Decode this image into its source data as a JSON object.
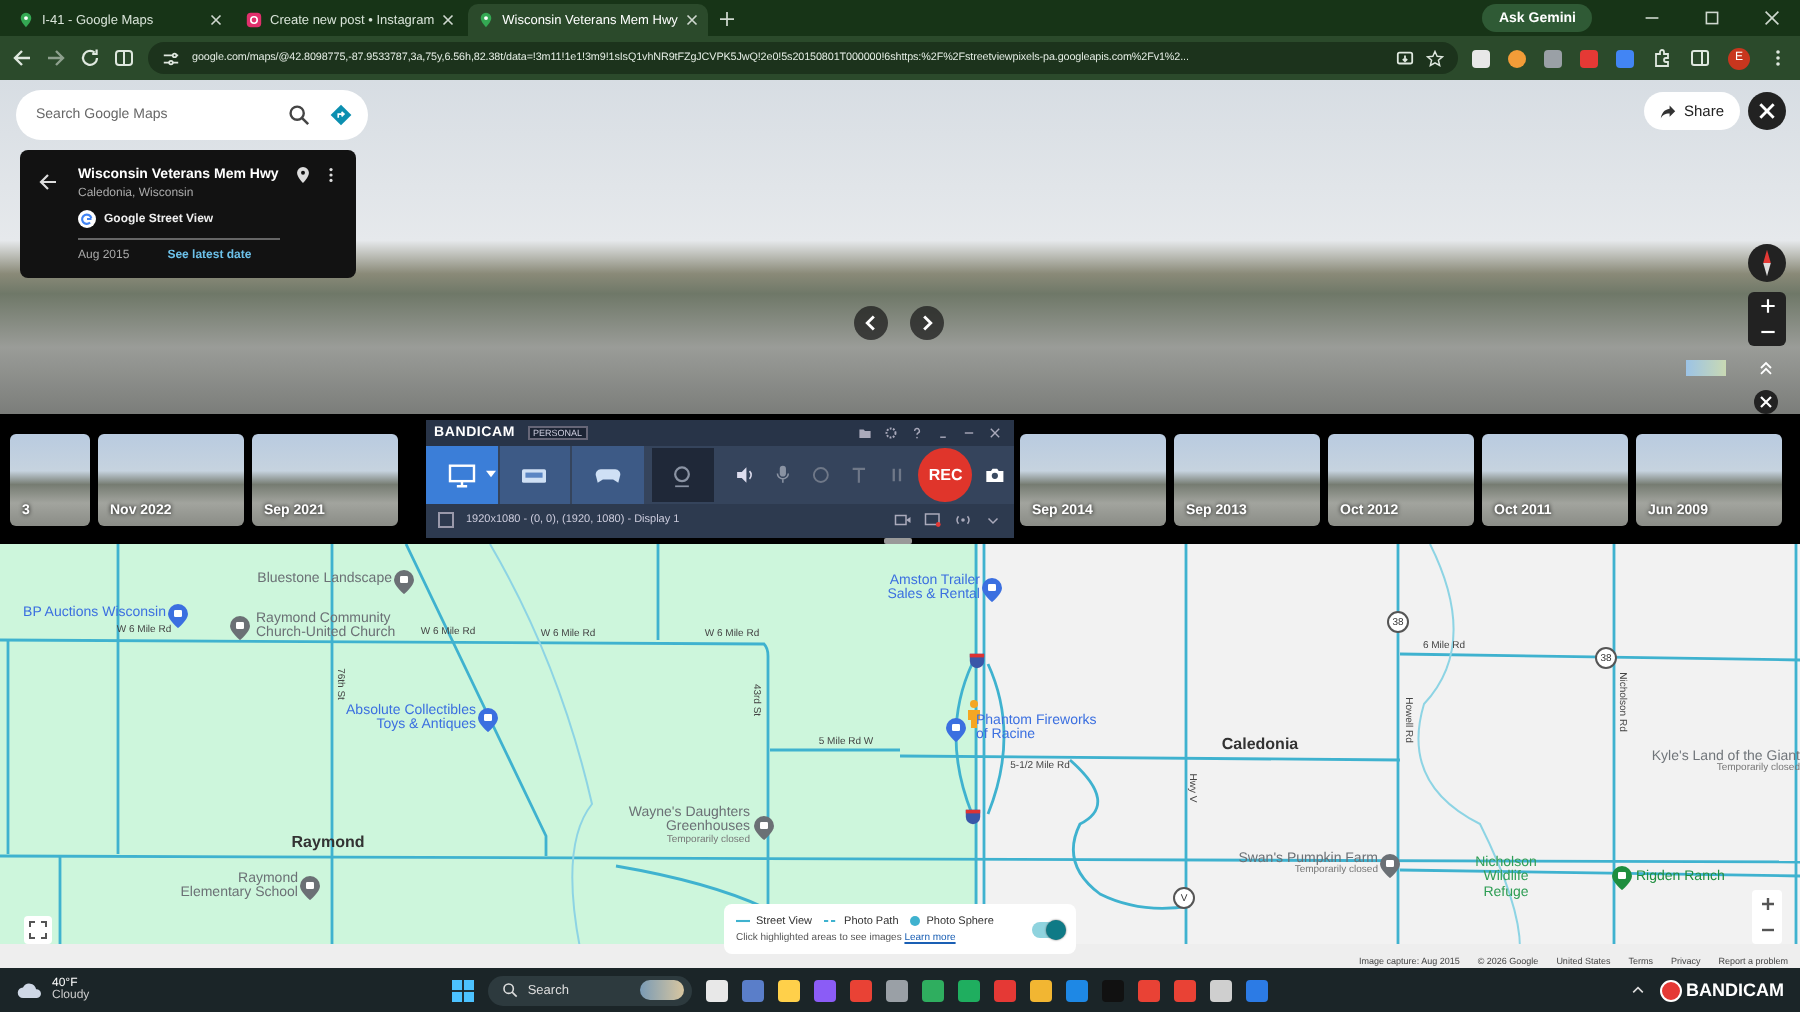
{
  "browser": {
    "tabs": [
      {
        "title": "I-41 - Google Maps",
        "kind": "maps",
        "selected": false
      },
      {
        "title": "Create new post • Instagram",
        "kind": "instagram",
        "selected": false
      },
      {
        "title": "Wisconsin Veterans Mem Hwy",
        "kind": "maps",
        "selected": true
      }
    ],
    "ask_button": "Ask Gemini",
    "url": "google.com/maps/@42.8098775,-87.9533787,3a,75y,6.56h,82.38t/data=!3m11!1e1!3m9!1sIsQ1vhNR9tFZgJCVPK5JwQ!2e0!5s20150801T000000!6shttps:%2F%2Fstreetviewpixels-pa.googleapis.com%2Fv1%2...",
    "avatar": "E"
  },
  "search": {
    "placeholder": "Search Google Maps"
  },
  "place_card": {
    "title": "Wisconsin Veterans Mem Hwy",
    "subtitle": "Caledonia, Wisconsin",
    "source": "Google Street View",
    "date": "Aug 2015",
    "link": "See latest date"
  },
  "share_button": "Share",
  "timeline": [
    {
      "label": "3",
      "selected": false
    },
    {
      "label": "Nov 2022",
      "selected": false
    },
    {
      "label": "Sep 2021",
      "selected": false
    },
    {
      "label": "Sep 2014",
      "selected": false
    },
    {
      "label": "Sep 2013",
      "selected": false
    },
    {
      "label": "Oct 2012",
      "selected": false
    },
    {
      "label": "Oct 2011",
      "selected": false
    },
    {
      "label": "Jun 2009",
      "selected": false
    }
  ],
  "recorder": {
    "brand": "BANDICAM",
    "edition": "PERSONAL",
    "modes": [
      {
        "kind": "screen",
        "selected": true
      },
      {
        "kind": "device",
        "selected": false
      },
      {
        "kind": "game",
        "selected": false
      }
    ],
    "rec_button": "REC",
    "target": "1920x1080 - (0, 0), (1920, 1080) - Display 1",
    "target_checked": false
  },
  "map": {
    "places": [
      {
        "name": "Bluestone Landscape",
        "kind": "landmark"
      },
      {
        "name": "Amston Trailer Sales & Rental",
        "kind": "shop"
      },
      {
        "name": "BP Auctions Wisconsin",
        "kind": "shop"
      },
      {
        "name": "Raymond Community Church-United Church",
        "kind": "landmark"
      },
      {
        "name": "Absolute Collectibles Toys & Antiques",
        "kind": "shop"
      },
      {
        "name": "Phantom Fireworks of Racine",
        "kind": "shop"
      },
      {
        "name": "Kyle's Land of the Giant",
        "kind": "label",
        "status": "Temporarily closed"
      },
      {
        "name": "Wayne's Daughters Greenhouses",
        "kind": "landmark",
        "status": "Temporarily closed"
      },
      {
        "name": "Raymond Elementary School",
        "kind": "landmark"
      },
      {
        "name": "Swan's Pumpkin Farm",
        "kind": "landmark",
        "status": "Temporarily closed"
      },
      {
        "name": "Nicholson Wildlife Refuge",
        "kind": "area"
      },
      {
        "name": "Rigden Ranch",
        "kind": "park"
      }
    ],
    "towns": [
      "Raymond",
      "Caledonia"
    ],
    "roads": [
      "W 6 Mile Rd",
      "W 6 Mile Rd",
      "W 6 Mile Rd",
      "W 6 Mile Rd",
      "76th St",
      "43rd St",
      "5 Mile Rd W",
      "5-1/2 Mile Rd",
      "6 Mile Rd",
      "Howell Rd",
      "Nicholson Rd",
      "Hwy V"
    ],
    "shields": [
      "38",
      "38",
      "V"
    ],
    "legend": {
      "items": [
        {
          "label": "Street View",
          "kind": "line"
        },
        {
          "label": "Photo Path",
          "kind": "dash"
        },
        {
          "label": "Photo Sphere",
          "kind": "dot"
        }
      ],
      "hint": "Click highlighted areas to see images",
      "link": "Learn more",
      "layer_on": true
    },
    "footer": [
      "Image capture: Aug 2015",
      "© 2026 Google",
      "United States",
      "Terms",
      "Privacy",
      "Report a problem"
    ]
  },
  "taskbar": {
    "weather": {
      "temp": "40°F",
      "condition": "Cloudy"
    },
    "search": "Search",
    "tray_brand": "BANDICAM"
  }
}
